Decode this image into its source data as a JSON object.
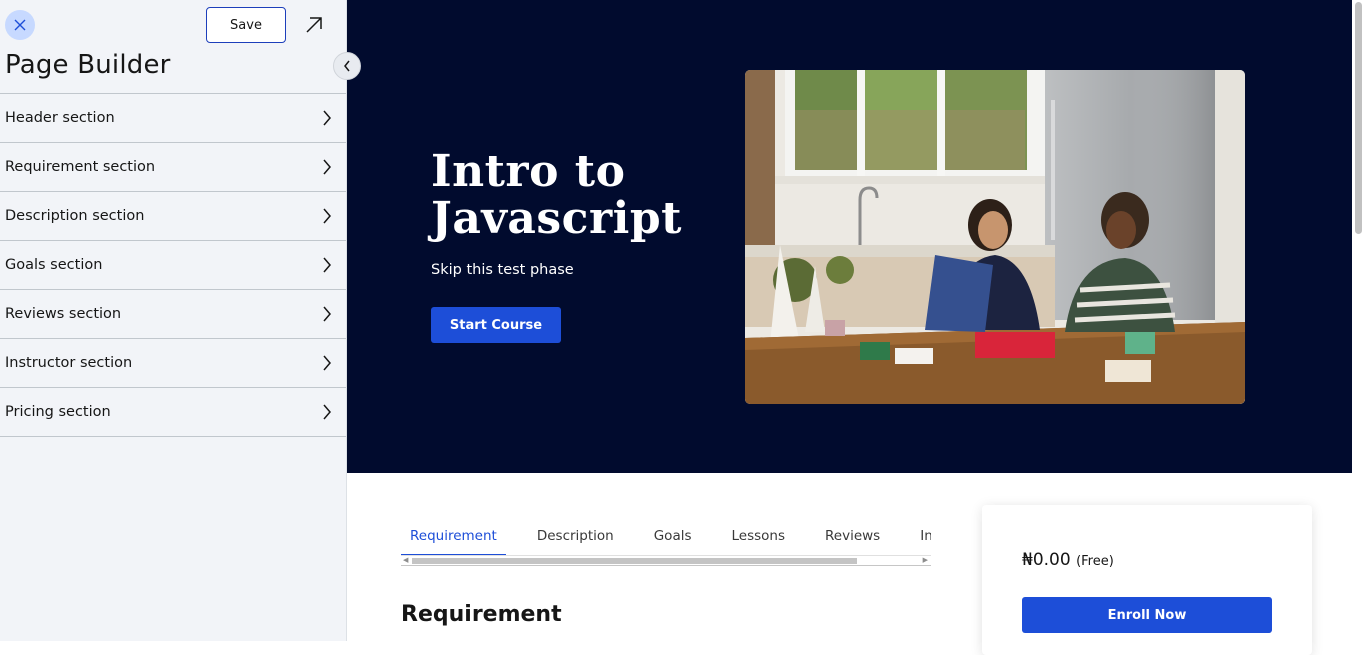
{
  "sidebar": {
    "save_label": "Save",
    "title": "Page Builder",
    "sections": [
      {
        "label": "Header section"
      },
      {
        "label": "Requirement section"
      },
      {
        "label": "Description section"
      },
      {
        "label": "Goals section"
      },
      {
        "label": "Reviews section"
      },
      {
        "label": "Instructor section"
      },
      {
        "label": "Pricing section"
      }
    ]
  },
  "hero": {
    "title": "Intro to Javascript",
    "subtitle": "Skip this test phase",
    "cta_label": "Start Course"
  },
  "tabs": [
    {
      "label": "Requirement",
      "active": true
    },
    {
      "label": "Description",
      "active": false
    },
    {
      "label": "Goals",
      "active": false
    },
    {
      "label": "Lessons",
      "active": false
    },
    {
      "label": "Reviews",
      "active": false
    },
    {
      "label": "Instructor",
      "active": false
    }
  ],
  "content": {
    "heading": "Requirement"
  },
  "pricing": {
    "price": "₦0.00",
    "note": "(Free)",
    "enroll_label": "Enroll Now"
  },
  "colors": {
    "primary": "#1d4ed8",
    "hero_bg": "#010b2e",
    "sidebar_bg": "#f2f4f8"
  }
}
